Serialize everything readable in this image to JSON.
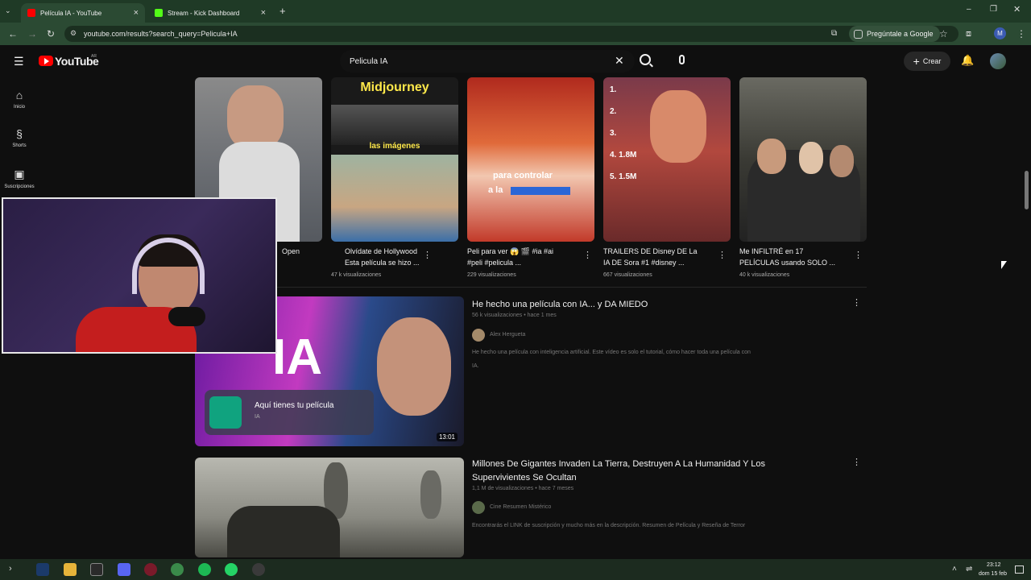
{
  "browser": {
    "tabs": [
      {
        "title": "Película IA - YouTube",
        "active": true
      },
      {
        "title": "Stream - Kick Dashboard",
        "active": false
      }
    ],
    "new_tab": "+",
    "url": "youtube.com/results?search_query=Pelicula+IA",
    "ask_google": "Pregúntale a Google",
    "profile_initial": "M"
  },
  "youtube": {
    "logo_text": "YouTube",
    "country": "AR",
    "search_value": "Pelicula IA",
    "create_label": "Crear",
    "sidebar": [
      {
        "label": "Inicio",
        "icon": "home-icon"
      },
      {
        "label": "Shorts",
        "icon": "shorts-icon"
      },
      {
        "label": "Suscripciones",
        "icon": "subscriptions-icon"
      }
    ],
    "shorts": [
      {
        "title_l1": "Open",
        "title_l2": "",
        "views": "",
        "thumb_text": ""
      },
      {
        "title_l1": "Olvídate de Hollywood",
        "title_l2": "Esta película se hizo ...",
        "views": "47 k visualizaciones",
        "thumb_text": "Midjourney",
        "thumb_text2": "las imágenes"
      },
      {
        "title_l1": "Peli para ver 😱 🎬 #ia #ai",
        "title_l2": "#peli #pelicula ...",
        "views": "229 visualizaciones",
        "thumb_text": "para controlar",
        "thumb_text2": "a la"
      },
      {
        "title_l1": "TRAILERS DE Disney DE La",
        "title_l2": "IA DE Sora #1 #disney ...",
        "views": "667 visualizaciones",
        "ranking": [
          "1.",
          "2.",
          "3.",
          "4. 1.8M",
          "5. 1.5M"
        ]
      },
      {
        "title_l1": "Me INFILTRÉ en 17",
        "title_l2": "PELÍCULAS usando SOLO ...",
        "views": "40 k visualizaciones"
      }
    ],
    "videos": [
      {
        "title": "He hecho una película con IA... y DA MIEDO",
        "stats": "56 k visualizaciones • hace 1 mes",
        "channel": "Alex Hergueta",
        "desc_l1": "He hecho una película con inteligencia artificial. Este vídeo es solo el tutorial, cómo hacer toda una película con",
        "desc_l2": "IA.",
        "duration": "13:01",
        "thumb_text": "IA",
        "overlay_text": "Aquí tienes tu película",
        "overlay_sub": "IA"
      },
      {
        "title_l1": "Millones De Gigantes Invaden La Tierra, Destruyen A La Humanidad Y Los",
        "title_l2": "Supervivientes Se Ocultan",
        "stats": "1,1 M de visualizaciones • hace 7 meses",
        "channel": "Cine Resumen Mistérico",
        "desc_l1": "Encontrarás el LINK de suscripción y mucho más en la descripción. Resumen de Película y Reseña de Terror"
      }
    ]
  },
  "taskbar": {
    "time": "23:12",
    "date": "dom 15 feb"
  }
}
